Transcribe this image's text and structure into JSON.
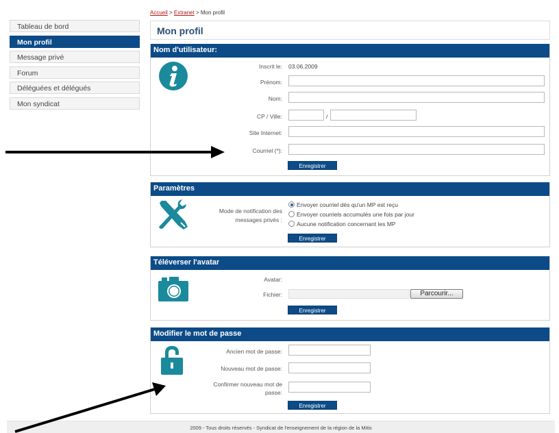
{
  "breadcrumb": {
    "home": "Accueil",
    "sep1": " > ",
    "extranet": "Extranet",
    "sep2": " > ",
    "current": "Mon profil"
  },
  "sidebar": {
    "items": [
      {
        "label": "Tableau de bord"
      },
      {
        "label": "Mon profil"
      },
      {
        "label": "Message privé"
      },
      {
        "label": "Forum"
      },
      {
        "label": "Déléguées et délégués"
      },
      {
        "label": "Mon syndicat"
      }
    ]
  },
  "page": {
    "title": "Mon profil"
  },
  "user_section": {
    "title": "Nom d'utilisateur:",
    "icon": "info-icon",
    "registered_label": "Inscrit le:",
    "registered_value": "03.06.2009",
    "firstname_label": "Prénom:",
    "lastname_label": "Nom:",
    "postal_label": "CP / Ville:",
    "postal_sep": "/",
    "website_label": "Site Internet:",
    "email_label": "Courriel (*):",
    "save": "Enregistrer"
  },
  "params_section": {
    "title": "Paramètres",
    "icon": "tools-icon",
    "notif_label_line1": "Mode de notification des",
    "notif_label_line2": "messages privés :",
    "options": [
      {
        "label": "Envoyer courriel dès qu'un MP est reçu",
        "checked": true
      },
      {
        "label": "Envoyer courriels accumulés une fois par jour",
        "checked": false
      },
      {
        "label": "Aucune notification concernant les MP",
        "checked": false
      }
    ],
    "save": "Enregistrer"
  },
  "avatar_section": {
    "title": "Téléverser l'avatar",
    "icon": "camera-icon",
    "avatar_label": "Avatar:",
    "file_label": "Fichier:",
    "browse": "Parcourir...",
    "save": "Enregistrer"
  },
  "password_section": {
    "title": "Modifier le mot de passe",
    "icon": "lock-icon",
    "old_label": "Ancien mot de passe:",
    "new_label": "Nouveau mot de passe:",
    "confirm_line1": "Confirmer nouveau mot de",
    "confirm_line2": "passe:",
    "save": "Enregistrer"
  },
  "footer": {
    "text": "2009 - Tous droits réservés - Syndicat de l'enseignement de la région de la Mitis"
  },
  "colors": {
    "accent": "#0c4b87",
    "icon": "#1a8a9c",
    "link": "#b01818"
  }
}
